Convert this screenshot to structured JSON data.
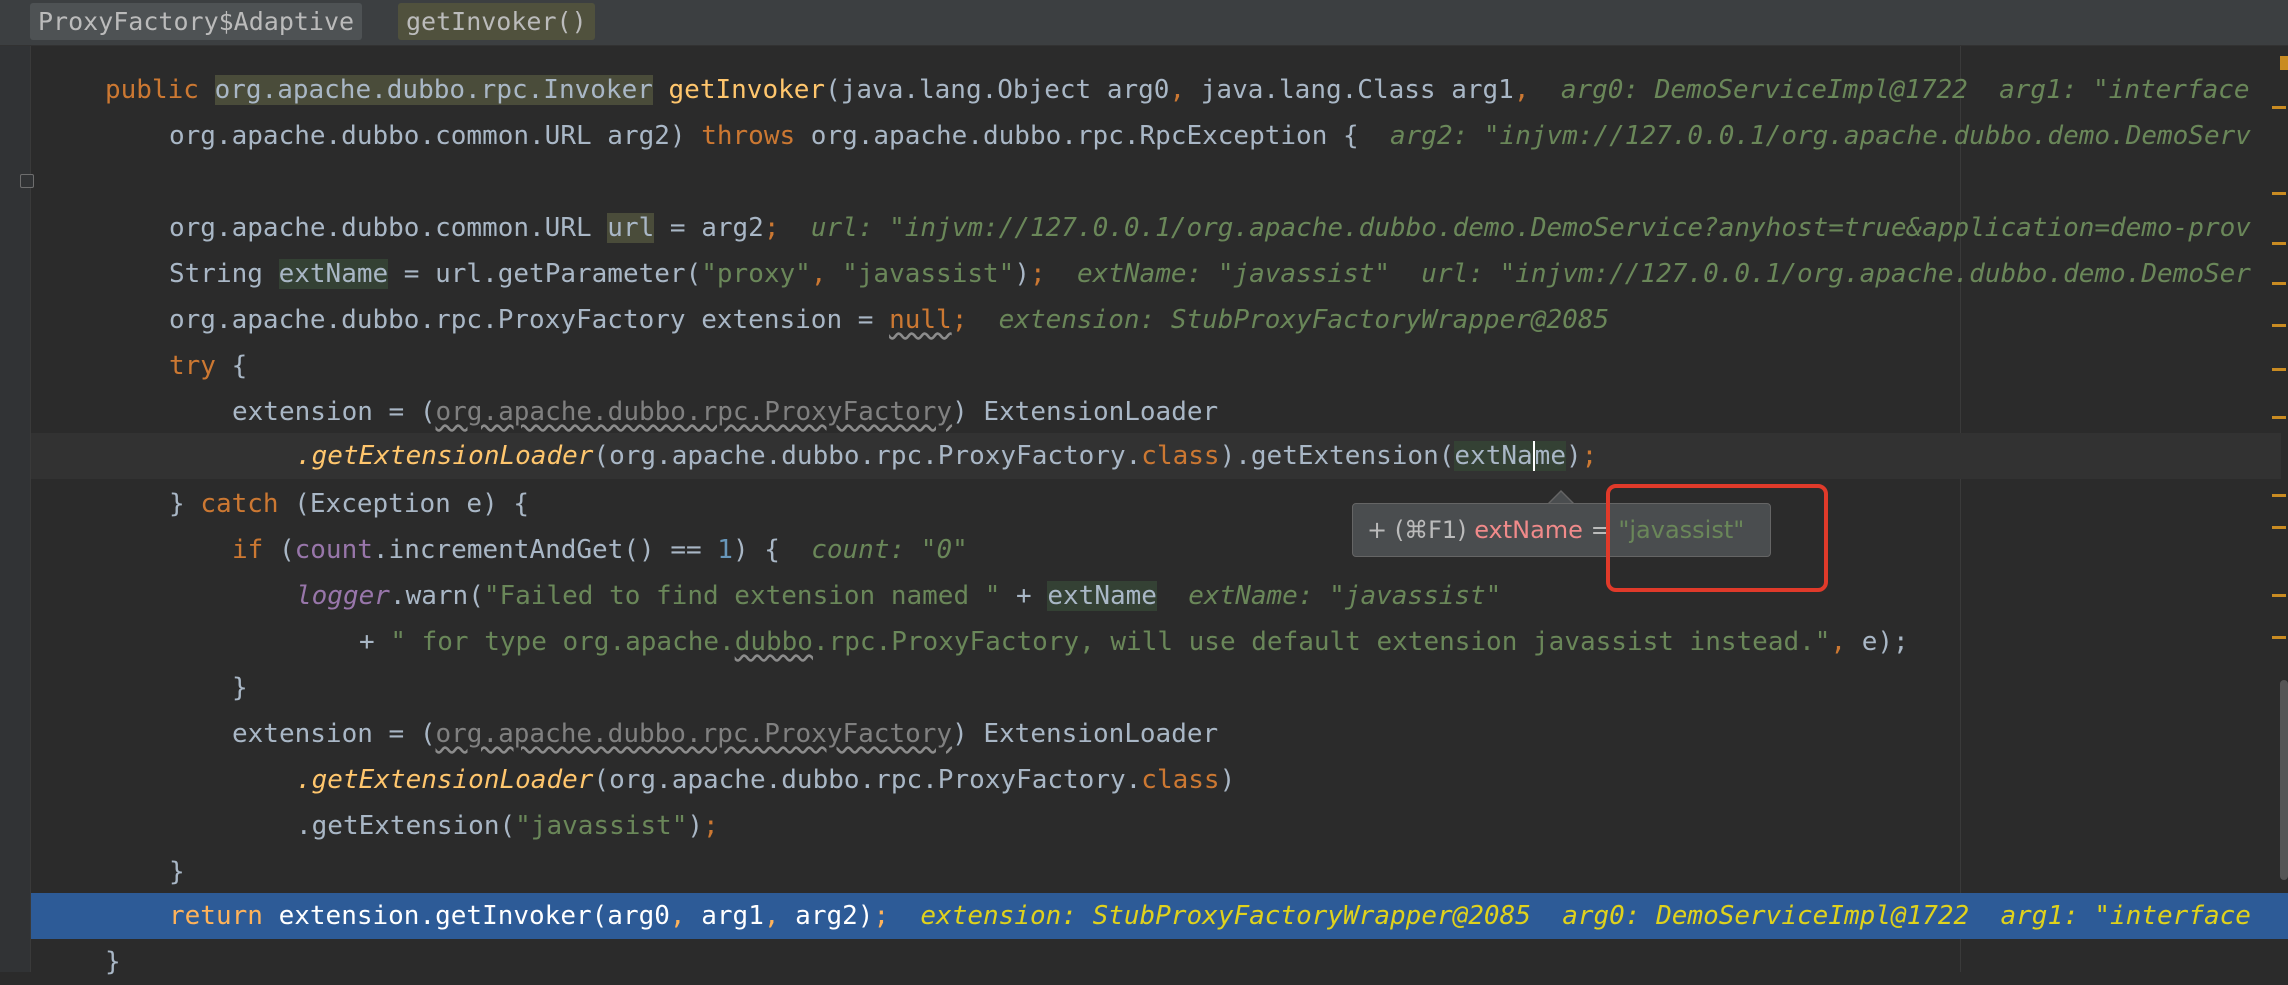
{
  "breadcrumb": {
    "class_name": "ProxyFactory$Adaptive",
    "method_name": "getInvoker()"
  },
  "tooltip": {
    "shortcut": "+ (⌘F1)",
    "var_name": "extName",
    "equals": " = ",
    "value": "\"javassist\""
  },
  "icons": [
    "expand-icon",
    "fold-icon"
  ],
  "colors": {
    "editor_bg": "#2b2b2b",
    "execution_line": "#2d5b97",
    "keyword": "#cc7832",
    "string": "#6a8759",
    "highlight_box": "#e03a2a"
  },
  "code": {
    "l1": {
      "kw": "public",
      "type": "org.apache.dubbo.rpc.Invoker",
      "name": "getInvoker",
      "params": "(java.lang.Object arg0",
      "params2": " java.lang.Class arg1",
      "hint": "arg0: DemoServiceImpl@1722  arg1: \"interface"
    },
    "l2": {
      "text1": "org.apache.dubbo.common.URL arg2) ",
      "kw": "throws",
      "text2": " org.apache.dubbo.rpc.RpcException {",
      "hint": "arg2: \"injvm://127.0.0.1/org.apache.dubbo.demo.DemoServ"
    },
    "l4": {
      "text1": "org.apache.dubbo.common.URL ",
      "var": "url",
      "text2": " = arg2",
      "hint": "url: \"injvm://127.0.0.1/org.apache.dubbo.demo.DemoService?anyhost=true&application=demo-prov"
    },
    "l5": {
      "text1": "String ",
      "var": "extName",
      "text2": " = url.getParameter(",
      "s1": "\"proxy\"",
      "s2": "\"javassist\"",
      "text3": ")",
      "hint": "extName: \"javassist\"  url: \"injvm://127.0.0.1/org.apache.dubbo.demo.DemoSer"
    },
    "l6": {
      "text1": "org.apache.dubbo.rpc.ProxyFactory extension = ",
      "null": "null",
      "hint": "extension: StubProxyFactoryWrapper@2085"
    },
    "l7": {
      "kw": "try",
      "text": " {"
    },
    "l8": {
      "text1": "extension = (",
      "cast": "org.apache.dubbo.rpc.ProxyFactory",
      "text2": ") ExtensionLoader"
    },
    "l9": {
      "method": ".getExtensionLoader",
      "text1": "(org.apache.dubbo.rpc.ProxyFactory.",
      "kw": "class",
      "text2": ").getExtension(",
      "arg1": "extNa",
      "arg2": "me",
      "text3": ")"
    },
    "l10": {
      "text1": "} ",
      "kw": "catch",
      "text2": " (Exception e) {"
    },
    "l11": {
      "kw": "if",
      "text1": " (",
      "field": "count",
      "text2": ".incrementAndGet() == ",
      "num": "1",
      "text3": ") {",
      "hint": "count: \"0\""
    },
    "l12": {
      "field": "logger",
      "text1": ".warn(",
      "str": "\"Failed to find extension named \"",
      "text2": " + ",
      "var": "extName",
      "hint": "extName: \"javassist\""
    },
    "l13": {
      "text1": "+ ",
      "str1": "\" for type org.apache.",
      "str2": "dubbo",
      "str3": ".rpc.ProxyFactory, will use default extension javassist instead.\"",
      "text2": " e);"
    },
    "l14": {
      "text": "}"
    },
    "l15": {
      "text1": "extension = (",
      "cast": "org.apache.dubbo.rpc.ProxyFactory",
      "text2": ") ExtensionLoader"
    },
    "l16": {
      "method": ".getExtensionLoader",
      "text1": "(org.apache.dubbo.rpc.ProxyFactory.",
      "kw": "class",
      "text2": ")"
    },
    "l17": {
      "text1": ".getExtension(",
      "str": "\"javassist\"",
      "text2": ")"
    },
    "l18": {
      "text": "}"
    },
    "l19": {
      "kw": "return",
      "text": " extension.getInvoker(arg0",
      "text2": " arg1",
      "text3": " arg2)",
      "hint": "extension: StubProxyFactoryWrapper@2085  arg0: DemoServiceImpl@1722  arg1: \"interface"
    },
    "l20": {
      "text": "}"
    }
  }
}
